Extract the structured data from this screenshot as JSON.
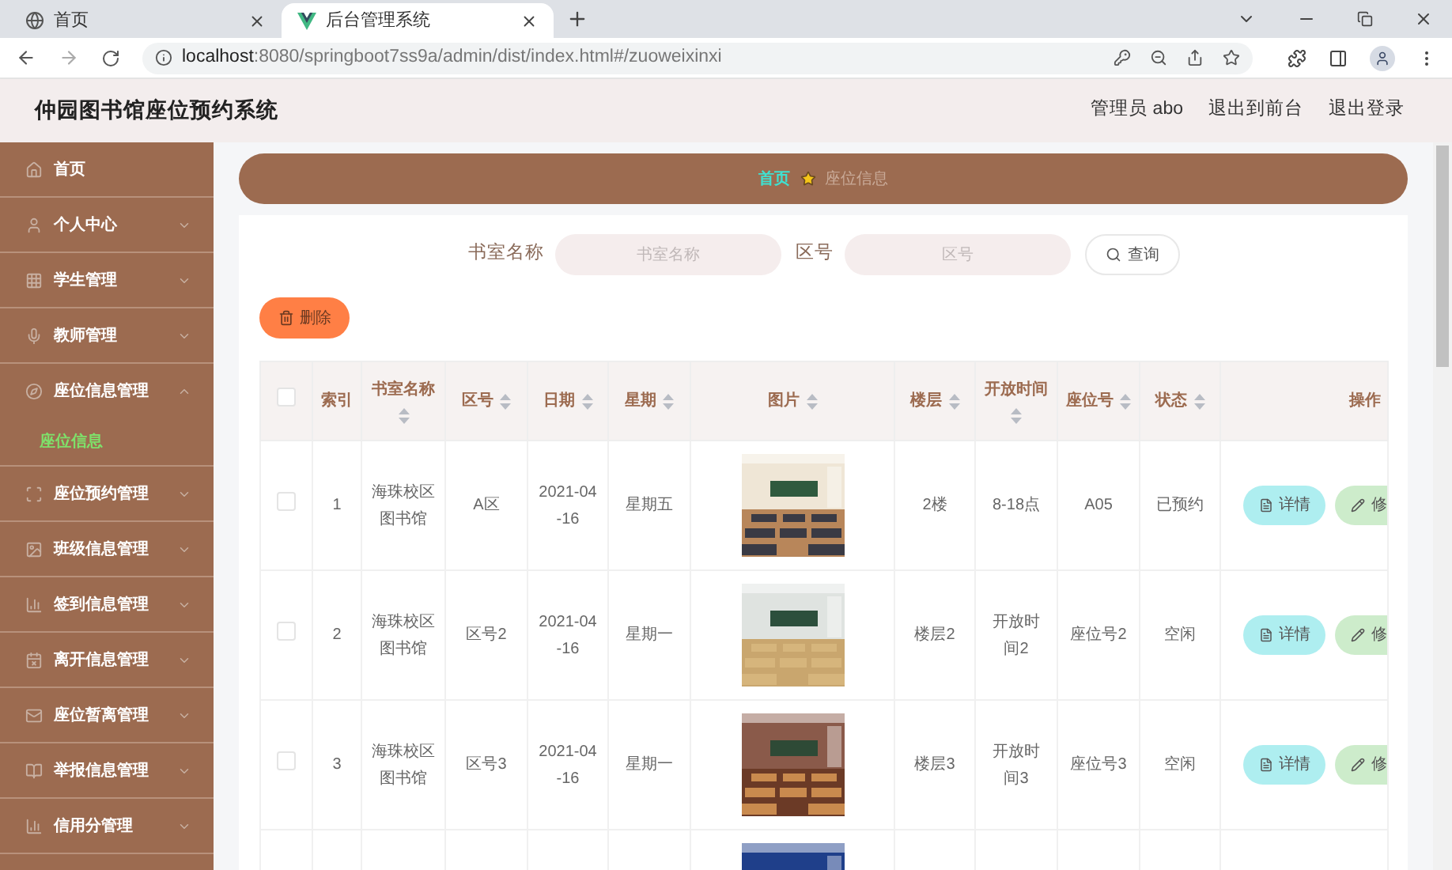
{
  "browser": {
    "tabs": [
      {
        "title": "首页",
        "selected": false
      },
      {
        "title": "后台管理系统",
        "selected": true
      }
    ],
    "url_host": "localhost",
    "url_rest": ":8080/springboot7ss9a/admin/dist/index.html#/zuoweixinxi"
  },
  "header": {
    "title": "仲园图书馆座位预约系统",
    "links": [
      "管理员 abo",
      "退出到前台",
      "退出登录"
    ]
  },
  "sidebar": {
    "items": [
      {
        "label": "首页",
        "kind": "link"
      },
      {
        "label": "个人中心",
        "kind": "group",
        "expanded": false
      },
      {
        "label": "学生管理",
        "kind": "group",
        "expanded": false
      },
      {
        "label": "教师管理",
        "kind": "group",
        "expanded": false
      },
      {
        "label": "座位信息管理",
        "kind": "group",
        "expanded": true,
        "children": [
          {
            "label": "座位信息",
            "selected": true
          }
        ]
      },
      {
        "label": "座位预约管理",
        "kind": "group",
        "expanded": false
      },
      {
        "label": "班级信息管理",
        "kind": "group",
        "expanded": false
      },
      {
        "label": "签到信息管理",
        "kind": "group",
        "expanded": false
      },
      {
        "label": "离开信息管理",
        "kind": "group",
        "expanded": false
      },
      {
        "label": "座位暂离管理",
        "kind": "group",
        "expanded": false
      },
      {
        "label": "举报信息管理",
        "kind": "group",
        "expanded": false
      },
      {
        "label": "信用分管理",
        "kind": "group",
        "expanded": false
      }
    ]
  },
  "breadcrumb": [
    "首页",
    "座位信息"
  ],
  "search": {
    "fields": [
      {
        "label": "书室名称",
        "placeholder": "书室名称"
      },
      {
        "label": "区号",
        "placeholder": "区号"
      }
    ],
    "button": "查询"
  },
  "delete_button": "删除",
  "table": {
    "header_checked": false,
    "columns": [
      {
        "label": "索引",
        "sortable": false
      },
      {
        "label": "书室名称",
        "sortable": true
      },
      {
        "label": "区号",
        "sortable": true
      },
      {
        "label": "日期",
        "sortable": true
      },
      {
        "label": "星期",
        "sortable": true
      },
      {
        "label": "图片",
        "sortable": true
      },
      {
        "label": "楼层",
        "sortable": true
      },
      {
        "label": "开放时间",
        "sortable": true
      },
      {
        "label": "座位号",
        "sortable": true
      },
      {
        "label": "状态",
        "sortable": true
      },
      {
        "label": "操作",
        "sortable": false
      }
    ],
    "rows": [
      {
        "checked": false,
        "cells": [
          "1",
          "海珠校区图书馆",
          "A区",
          "2021-04-16",
          "星期五",
          {
            "kind": "picture"
          },
          "2楼",
          "8-18点",
          "A05",
          "已预约"
        ],
        "actions": [
          "详情",
          "修"
        ]
      },
      {
        "checked": false,
        "cells": [
          "2",
          "海珠校区图书馆",
          "区号2",
          "2021-04-16",
          "星期一",
          {
            "kind": "picture"
          },
          "楼层2",
          "开放时间2",
          "座位号2",
          "空闲"
        ],
        "actions": [
          "详情",
          "修"
        ]
      },
      {
        "checked": false,
        "cells": [
          "3",
          "海珠校区图书馆",
          "区号3",
          "2021-04-16",
          "星期一",
          {
            "kind": "picture"
          },
          "楼层3",
          "开放时间3",
          "座位号3",
          "空闲"
        ],
        "actions": [
          "详情",
          "修"
        ]
      },
      {
        "cells": [
          "",
          "",
          "",
          "",
          "",
          {
            "kind": "picture"
          },
          "",
          "",
          "",
          ""
        ]
      }
    ]
  }
}
